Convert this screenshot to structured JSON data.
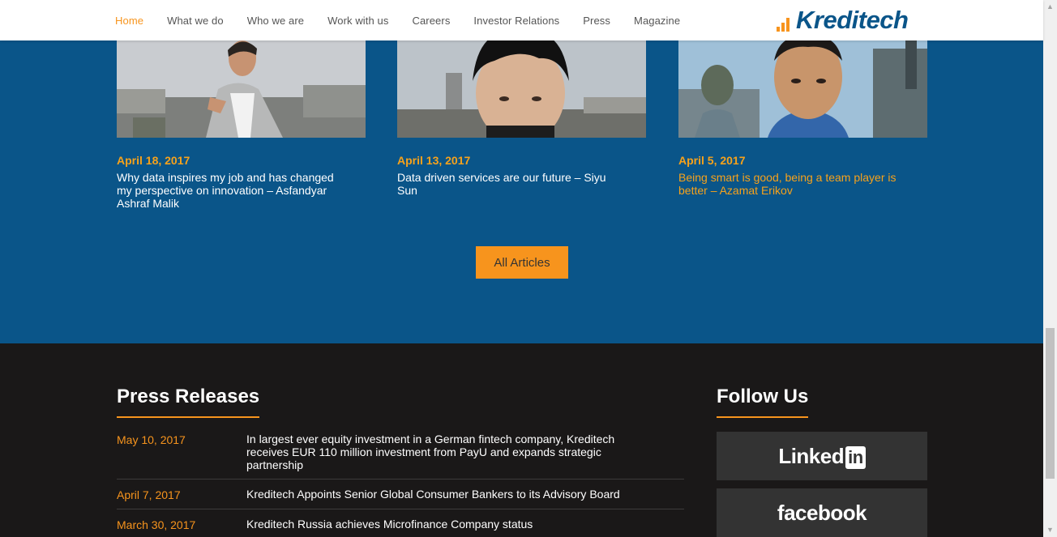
{
  "nav": {
    "items": [
      {
        "label": "Home",
        "active": true
      },
      {
        "label": "What we do"
      },
      {
        "label": "Who we are"
      },
      {
        "label": "Work with us"
      },
      {
        "label": "Careers"
      },
      {
        "label": "Investor Relations"
      },
      {
        "label": "Press"
      },
      {
        "label": "Magazine"
      }
    ]
  },
  "logo": {
    "text": "Kreditech",
    "icon": "signal-bars-icon"
  },
  "articles": [
    {
      "date": "April 18, 2017",
      "title": "Why data inspires my job and has changed my perspective on innovation – Asfandyar Ashraf Malik"
    },
    {
      "date": "April 13, 2017",
      "title": "Data driven services are our future – Siyu Sun"
    },
    {
      "date": "April 5, 2017",
      "title": "Being smart is good, being a team player is better – Azamat Erikov",
      "highlighted": true
    }
  ],
  "all_articles_label": "All Articles",
  "press": {
    "title": "Press Releases",
    "items": [
      {
        "date": "May 10, 2017",
        "text": "In largest ever equity investment in a German fintech company, Kreditech receives EUR 110 million investment from PayU and expands strategic partnership"
      },
      {
        "date": "April 7, 2017",
        "text": "Kreditech Appoints Senior Global Consumer Bankers to its Advisory Board"
      },
      {
        "date": "March 30, 2017",
        "text": "Kreditech Russia achieves Microfinance Company status"
      }
    ]
  },
  "follow": {
    "title": "Follow Us",
    "linkedin": {
      "word": "Linked",
      "box": "in"
    },
    "facebook": {
      "word": "facebook"
    }
  },
  "colors": {
    "brand_blue": "#0a5589",
    "accent_orange": "#f7941d",
    "footer_bg": "#1a1818"
  }
}
